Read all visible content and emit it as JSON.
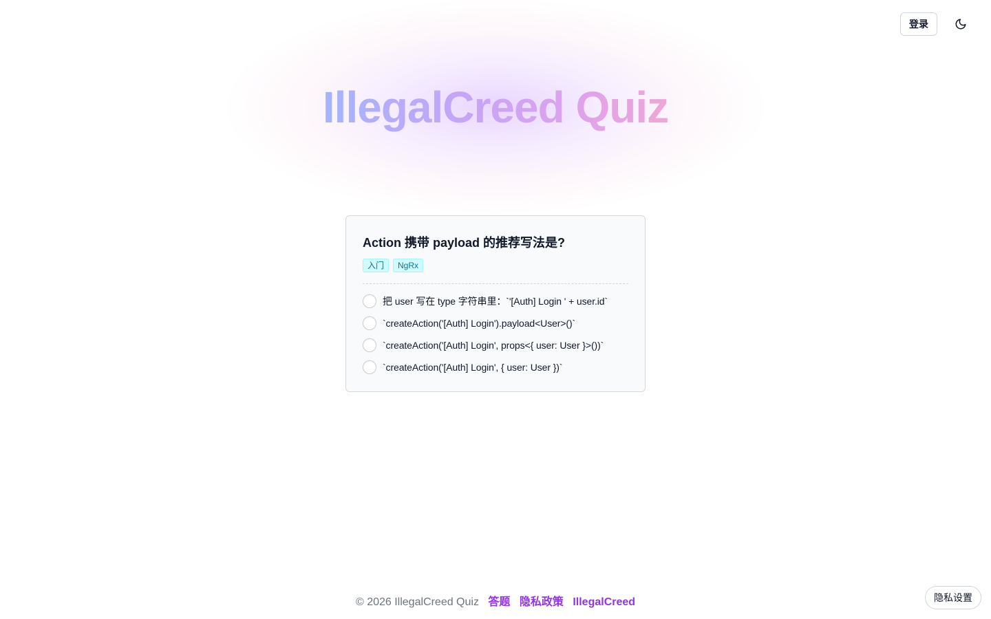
{
  "header": {
    "login_label": "登录",
    "theme_icon": "moon-icon"
  },
  "hero": {
    "title": "IllegalCreed Quiz"
  },
  "quiz": {
    "question": "Action 携带 payload 的推荐写法是?",
    "tags": [
      "入门",
      "NgRx"
    ],
    "options": [
      "把 user 写在 type 字符串里：`'[Auth] Login ' + user.id`",
      "`createAction('[Auth] Login').payload<User>()`",
      "`createAction('[Auth] Login', props<{ user: User }>())`",
      "`createAction('[Auth] Login', { user: User })`"
    ]
  },
  "footer": {
    "copyright": "© 2026 IllegalCreed Quiz",
    "links": [
      "答题",
      "隐私政策",
      "IllegalCreed"
    ],
    "privacy_settings_label": "隐私设置"
  },
  "colors": {
    "accent": "#9333ea",
    "tag_bg": "#cffafe",
    "tag_text": "#0e7490"
  }
}
